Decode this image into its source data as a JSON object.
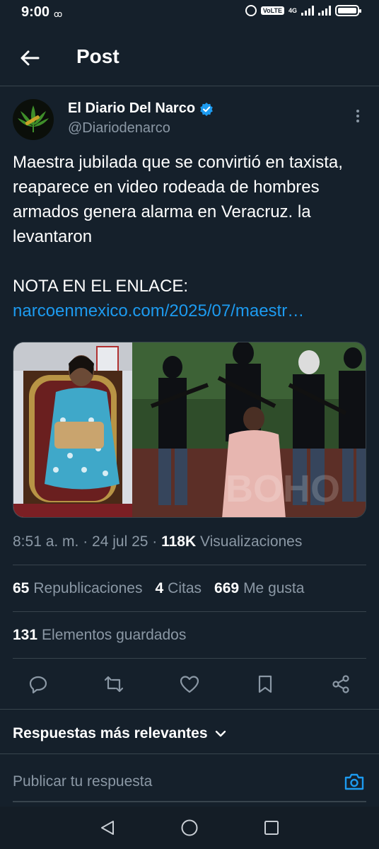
{
  "status": {
    "time": "9:00",
    "voicemail": "ꝏ",
    "volte": "VoLTE",
    "network": "4G"
  },
  "header": {
    "title": "Post"
  },
  "post": {
    "author_name": "El Diario Del Narco",
    "author_handle": "@Diariodenarco",
    "text": "Maestra jubilada que se convirtió en taxista, reaparece en video rodeada de hombres armados genera alarma en Veracruz. la levantaron\n\nNOTA EN EL ENLACE:",
    "link": "narcoenmexico.com/2025/07/maestr…",
    "time": "8:51 a. m. · 24 jul 25 · ",
    "views_count": "118K",
    "views_label": " Visualizaciones",
    "reposts_count": "65",
    "reposts_label": "Republicaciones",
    "quotes_count": "4",
    "quotes_label": "Citas",
    "likes_count": "669",
    "likes_label": "Me gusta",
    "bookmarks_count": "131",
    "bookmarks_label": "Elementos guardados",
    "media_watermark": "BOHO"
  },
  "replies": {
    "sort_label": "Respuestas más relevantes",
    "input_placeholder": "Publicar tu respuesta"
  },
  "colors": {
    "background": "#15202b",
    "accent": "#1d9bf0",
    "secondary_text": "#8b98a5",
    "divider": "#38444d"
  },
  "icons": {
    "back": "arrow-left-icon",
    "verified": "verified-badge-icon",
    "more": "more-vertical-icon",
    "reply": "reply-icon",
    "repost": "repost-icon",
    "like": "heart-icon",
    "bookmark": "bookmark-icon",
    "share": "share-icon",
    "chevron": "chevron-down-icon",
    "camera": "camera-icon"
  }
}
